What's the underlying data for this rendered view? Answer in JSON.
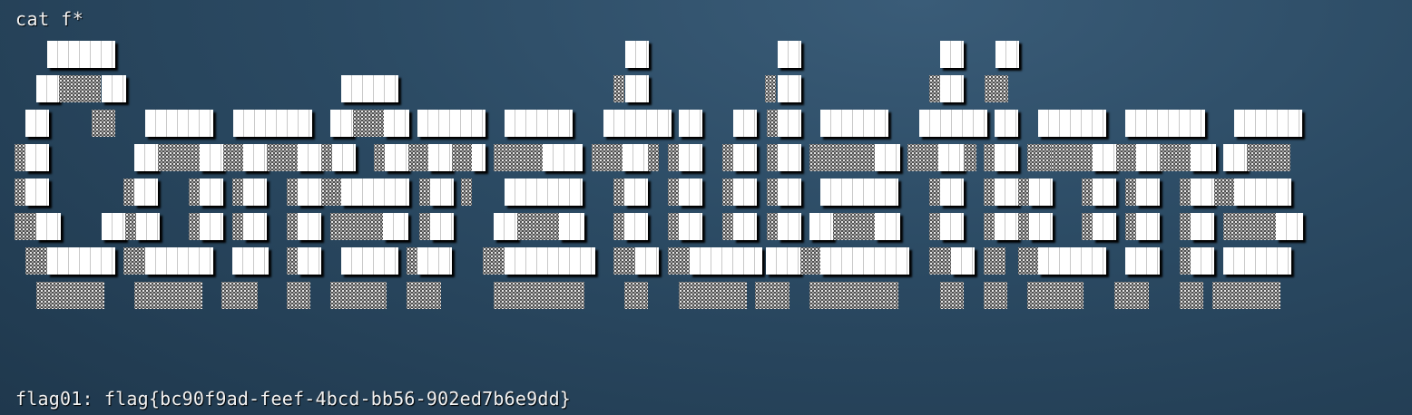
{
  "terminal": {
    "command": "cat f*",
    "output_line": "flag01: flag{bc90f9ad-feef-4bcd-bb56-902ed7b6e9dd}"
  },
  "colors": {
    "background": "#2b4a63",
    "text": "#f2f2f2",
    "block_fill": "#ffffff",
    "block_shadow_dots": "#e6e6e6"
  },
  "banner_art": {
    "style": "ansi-shadow block letters",
    "icon": "ascii-art-banner"
  }
}
